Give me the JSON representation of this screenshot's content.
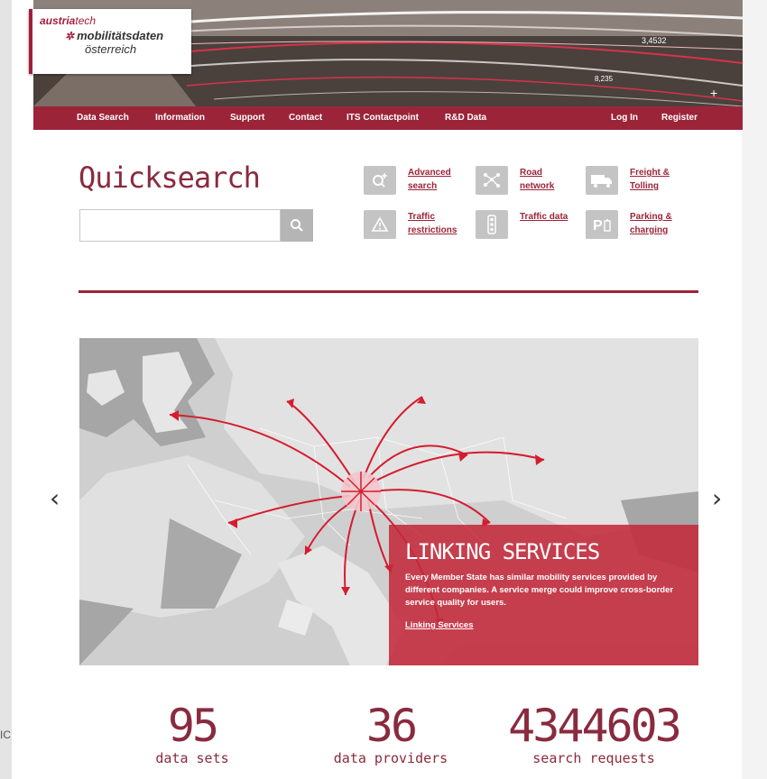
{
  "side_text": "IC",
  "header": {
    "brand_top": "austria",
    "brand_top_suffix": "tech",
    "brand_line2": "mobilitätsdaten",
    "brand_line3": "österreich",
    "hero_num1": "3,4532",
    "hero_num2": "8,235"
  },
  "nav": {
    "items": [
      "Data Search",
      "Information",
      "Support",
      "Contact",
      "ITS Contactpoint",
      "R&D Data"
    ],
    "login": "Log In",
    "register": "Register"
  },
  "quicksearch": {
    "title": "Quicksearch",
    "placeholder": "",
    "links": [
      {
        "label": "Advanced search",
        "icon": "search-plus-icon"
      },
      {
        "label": "Road network",
        "icon": "network-icon"
      },
      {
        "label": "Freight & Tolling",
        "icon": "truck-icon"
      },
      {
        "label": "Traffic restrictions",
        "icon": "warning-icon"
      },
      {
        "label": "Traffic data",
        "icon": "traffic-light-icon"
      },
      {
        "label": "Parking & charging",
        "icon": "parking-icon"
      }
    ]
  },
  "carousel": {
    "title": "LINKING SERVICES",
    "text": "Every Member State has similar mobility services provided by different companies. A service merge could improve cross-border service quality for users.",
    "link": "Linking Services",
    "prev_icon": "chevron-left-icon",
    "next_icon": "chevron-right-icon"
  },
  "stats": [
    {
      "value": "95",
      "label": "data sets"
    },
    {
      "value": "36",
      "label": "data providers"
    },
    {
      "value": "4344603",
      "label": "search requests"
    }
  ],
  "colors": {
    "brand": "#9b2439",
    "overlay": "#c42a3b"
  }
}
